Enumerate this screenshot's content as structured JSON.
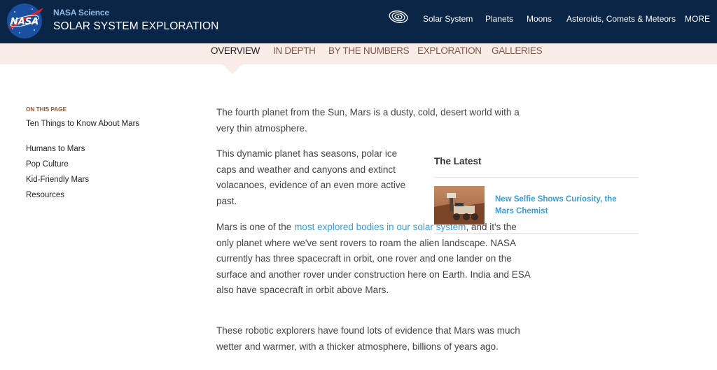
{
  "header": {
    "brand_small": "NASA Science",
    "brand_large": "SOLAR SYSTEM EXPLORATION",
    "logo_icon": "nasa-meatball-logo",
    "nav_icon": "orbit-icon",
    "nav": [
      "Solar System",
      "Planets",
      "Moons",
      "Asteroids, Comets & Meteors",
      "MORE"
    ]
  },
  "subnav": {
    "tabs": [
      "OVERVIEW",
      "IN DEPTH",
      "BY THE NUMBERS",
      "EXPLORATION",
      "GALLERIES"
    ],
    "active": "OVERVIEW"
  },
  "sidebar": {
    "heading": "ON THIS PAGE",
    "links": [
      "Ten Things to Know About Mars",
      "Humans to Mars",
      "Pop Culture",
      "Kid-Friendly Mars",
      "Resources"
    ]
  },
  "main": {
    "p1": "The fourth planet from the Sun, Mars is a dusty, cold, desert world with a very thin atmosphere.",
    "p2": "This dynamic planet has seasons, polar ice caps and weather and canyons and extinct volacanoes, evidence of an even more active past.",
    "p3_before": "Mars is one of the ",
    "p3_link": "most explored bodies in our solar system",
    "p3_after": ", and it's the only planet where we've sent rovers to roam the alien landscape. NASA currently has three spacecraft in orbit, one rover and one lander on the surface and another rover under construction here on Earth. India and ESA also have spacecraft in orbit above Mars.",
    "p4": "These robotic explorers have found lots of evidence that Mars was much wetter and warmer, with a thicker atmosphere, billions of years ago."
  },
  "latest": {
    "heading": "The Latest",
    "item_title": "New Selfie Shows Curiosity, the Mars Chemist",
    "item_image": "curiosity-rover-selfie-thumbnail"
  },
  "colors": {
    "header_bg": "#0b2546",
    "subnav_bg": "#f9ece6",
    "link": "#3a9bd9",
    "sidebar_heading": "#9a5d3a"
  }
}
